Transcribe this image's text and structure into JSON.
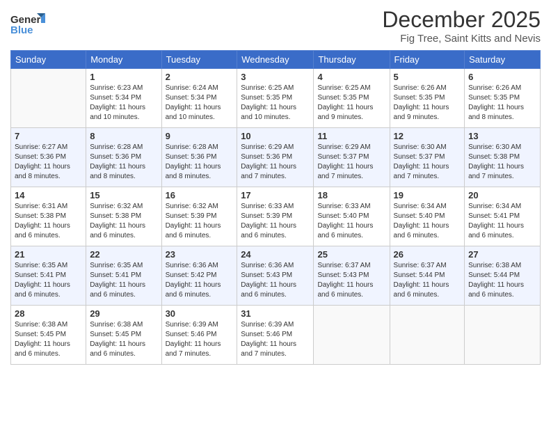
{
  "logo": {
    "general": "General",
    "blue": "Blue"
  },
  "title": "December 2025",
  "location": "Fig Tree, Saint Kitts and Nevis",
  "days_of_week": [
    "Sunday",
    "Monday",
    "Tuesday",
    "Wednesday",
    "Thursday",
    "Friday",
    "Saturday"
  ],
  "weeks": [
    [
      {
        "day": null
      },
      {
        "day": 1,
        "sunrise": "6:23 AM",
        "sunset": "5:34 PM",
        "daylight": "11 hours and 10 minutes."
      },
      {
        "day": 2,
        "sunrise": "6:24 AM",
        "sunset": "5:34 PM",
        "daylight": "11 hours and 10 minutes."
      },
      {
        "day": 3,
        "sunrise": "6:25 AM",
        "sunset": "5:35 PM",
        "daylight": "11 hours and 10 minutes."
      },
      {
        "day": 4,
        "sunrise": "6:25 AM",
        "sunset": "5:35 PM",
        "daylight": "11 hours and 9 minutes."
      },
      {
        "day": 5,
        "sunrise": "6:26 AM",
        "sunset": "5:35 PM",
        "daylight": "11 hours and 9 minutes."
      },
      {
        "day": 6,
        "sunrise": "6:26 AM",
        "sunset": "5:35 PM",
        "daylight": "11 hours and 8 minutes."
      }
    ],
    [
      {
        "day": 7,
        "sunrise": "6:27 AM",
        "sunset": "5:36 PM",
        "daylight": "11 hours and 8 minutes."
      },
      {
        "day": 8,
        "sunrise": "6:28 AM",
        "sunset": "5:36 PM",
        "daylight": "11 hours and 8 minutes."
      },
      {
        "day": 9,
        "sunrise": "6:28 AM",
        "sunset": "5:36 PM",
        "daylight": "11 hours and 8 minutes."
      },
      {
        "day": 10,
        "sunrise": "6:29 AM",
        "sunset": "5:36 PM",
        "daylight": "11 hours and 7 minutes."
      },
      {
        "day": 11,
        "sunrise": "6:29 AM",
        "sunset": "5:37 PM",
        "daylight": "11 hours and 7 minutes."
      },
      {
        "day": 12,
        "sunrise": "6:30 AM",
        "sunset": "5:37 PM",
        "daylight": "11 hours and 7 minutes."
      },
      {
        "day": 13,
        "sunrise": "6:30 AM",
        "sunset": "5:38 PM",
        "daylight": "11 hours and 7 minutes."
      }
    ],
    [
      {
        "day": 14,
        "sunrise": "6:31 AM",
        "sunset": "5:38 PM",
        "daylight": "11 hours and 6 minutes."
      },
      {
        "day": 15,
        "sunrise": "6:32 AM",
        "sunset": "5:38 PM",
        "daylight": "11 hours and 6 minutes."
      },
      {
        "day": 16,
        "sunrise": "6:32 AM",
        "sunset": "5:39 PM",
        "daylight": "11 hours and 6 minutes."
      },
      {
        "day": 17,
        "sunrise": "6:33 AM",
        "sunset": "5:39 PM",
        "daylight": "11 hours and 6 minutes."
      },
      {
        "day": 18,
        "sunrise": "6:33 AM",
        "sunset": "5:40 PM",
        "daylight": "11 hours and 6 minutes."
      },
      {
        "day": 19,
        "sunrise": "6:34 AM",
        "sunset": "5:40 PM",
        "daylight": "11 hours and 6 minutes."
      },
      {
        "day": 20,
        "sunrise": "6:34 AM",
        "sunset": "5:41 PM",
        "daylight": "11 hours and 6 minutes."
      }
    ],
    [
      {
        "day": 21,
        "sunrise": "6:35 AM",
        "sunset": "5:41 PM",
        "daylight": "11 hours and 6 minutes."
      },
      {
        "day": 22,
        "sunrise": "6:35 AM",
        "sunset": "5:41 PM",
        "daylight": "11 hours and 6 minutes."
      },
      {
        "day": 23,
        "sunrise": "6:36 AM",
        "sunset": "5:42 PM",
        "daylight": "11 hours and 6 minutes."
      },
      {
        "day": 24,
        "sunrise": "6:36 AM",
        "sunset": "5:43 PM",
        "daylight": "11 hours and 6 minutes."
      },
      {
        "day": 25,
        "sunrise": "6:37 AM",
        "sunset": "5:43 PM",
        "daylight": "11 hours and 6 minutes."
      },
      {
        "day": 26,
        "sunrise": "6:37 AM",
        "sunset": "5:44 PM",
        "daylight": "11 hours and 6 minutes."
      },
      {
        "day": 27,
        "sunrise": "6:38 AM",
        "sunset": "5:44 PM",
        "daylight": "11 hours and 6 minutes."
      }
    ],
    [
      {
        "day": 28,
        "sunrise": "6:38 AM",
        "sunset": "5:45 PM",
        "daylight": "11 hours and 6 minutes."
      },
      {
        "day": 29,
        "sunrise": "6:38 AM",
        "sunset": "5:45 PM",
        "daylight": "11 hours and 6 minutes."
      },
      {
        "day": 30,
        "sunrise": "6:39 AM",
        "sunset": "5:46 PM",
        "daylight": "11 hours and 7 minutes."
      },
      {
        "day": 31,
        "sunrise": "6:39 AM",
        "sunset": "5:46 PM",
        "daylight": "11 hours and 7 minutes."
      },
      {
        "day": null
      },
      {
        "day": null
      },
      {
        "day": null
      }
    ]
  ]
}
